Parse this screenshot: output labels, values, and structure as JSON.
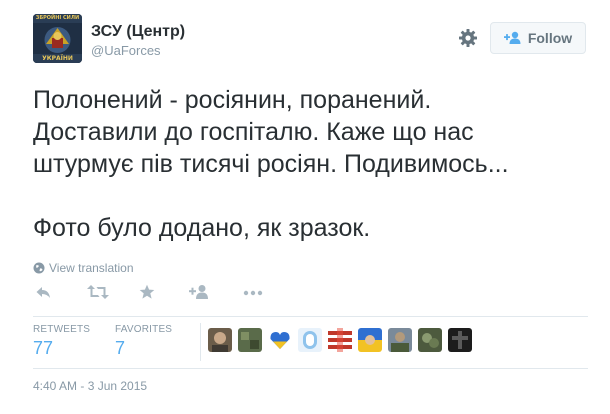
{
  "user": {
    "name": "ЗСУ (Центр)",
    "handle": "@UaForces",
    "avatar_text_top": "ЗБРОЙНІ СИЛИ",
    "avatar_text_bottom": "УКРАЇНИ"
  },
  "follow_button": {
    "label": "Follow",
    "icon": "add-person-icon"
  },
  "settings_icon": "gear-icon",
  "tweet": {
    "line1": "Полонений - росіянин, поранений.",
    "line2": "Доставили до госпіталю. Каже що нас",
    "line3": "штурмує пів тисячі росіян. Подивимось...",
    "line4": "Фото було додано, як зразок."
  },
  "translation": {
    "label": "View translation",
    "icon": "globe-icon"
  },
  "actions": [
    "reply-icon",
    "retweet-icon",
    "favorite-icon",
    "follow-icon",
    "more-icon"
  ],
  "stats": {
    "retweets_label": "RETWEETS",
    "retweets_count": "77",
    "favorites_label": "FAVORITES",
    "favorites_count": "7"
  },
  "favoriter_avatars": [
    "avatar-1",
    "avatar-2",
    "avatar-3",
    "avatar-4",
    "avatar-5",
    "avatar-6",
    "avatar-7",
    "avatar-8",
    "avatar-9"
  ],
  "timestamp": "4:40 AM - 3 Jun 2015",
  "colors": {
    "link_blue": "#55acee",
    "muted": "#8899a6",
    "text": "#292f33",
    "border": "#e1e8ed"
  }
}
